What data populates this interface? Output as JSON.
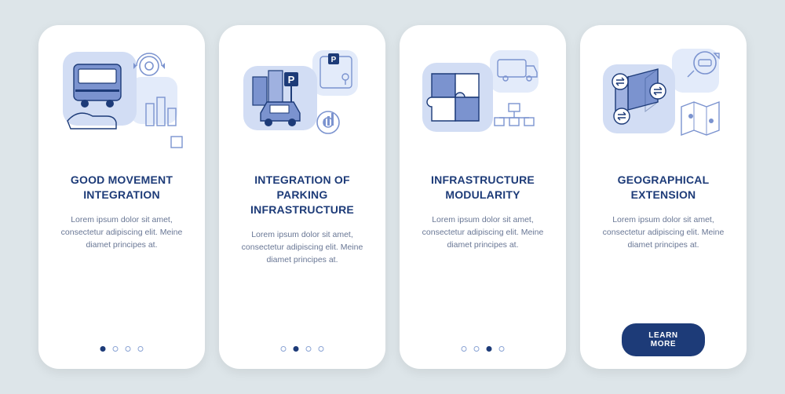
{
  "colors": {
    "accent": "#1d3b78",
    "fill": "#7b93cf",
    "light": "#c4d3f0",
    "stroke": "#1d3b78"
  },
  "screens": [
    {
      "title": "Good Movement\nIntegration",
      "description": "Lorem ipsum dolor sit amet, consectetur adipiscing elit. Meine diamet principes at.",
      "active_dot": 0,
      "show_dots": true,
      "illustration": "bus-hand"
    },
    {
      "title": "Integration of\nParking\nInfrastructure",
      "description": "Lorem ipsum dolor sit amet, consectetur adipiscing elit. Meine diamet principes at.",
      "active_dot": 1,
      "show_dots": true,
      "illustration": "parking-gear"
    },
    {
      "title": "Infrastructure\nModularity",
      "description": "Lorem ipsum dolor sit amet, consectetur adipiscing elit. Meine diamet principes at.",
      "active_dot": 2,
      "show_dots": true,
      "illustration": "puzzle"
    },
    {
      "title": "Geographical\nExtension",
      "description": "Lorem ipsum dolor sit amet, consectetur adipiscing elit. Meine diamet principes at.",
      "active_dot": 3,
      "show_dots": false,
      "cta": "LEARN MORE",
      "illustration": "geo-map"
    }
  ]
}
